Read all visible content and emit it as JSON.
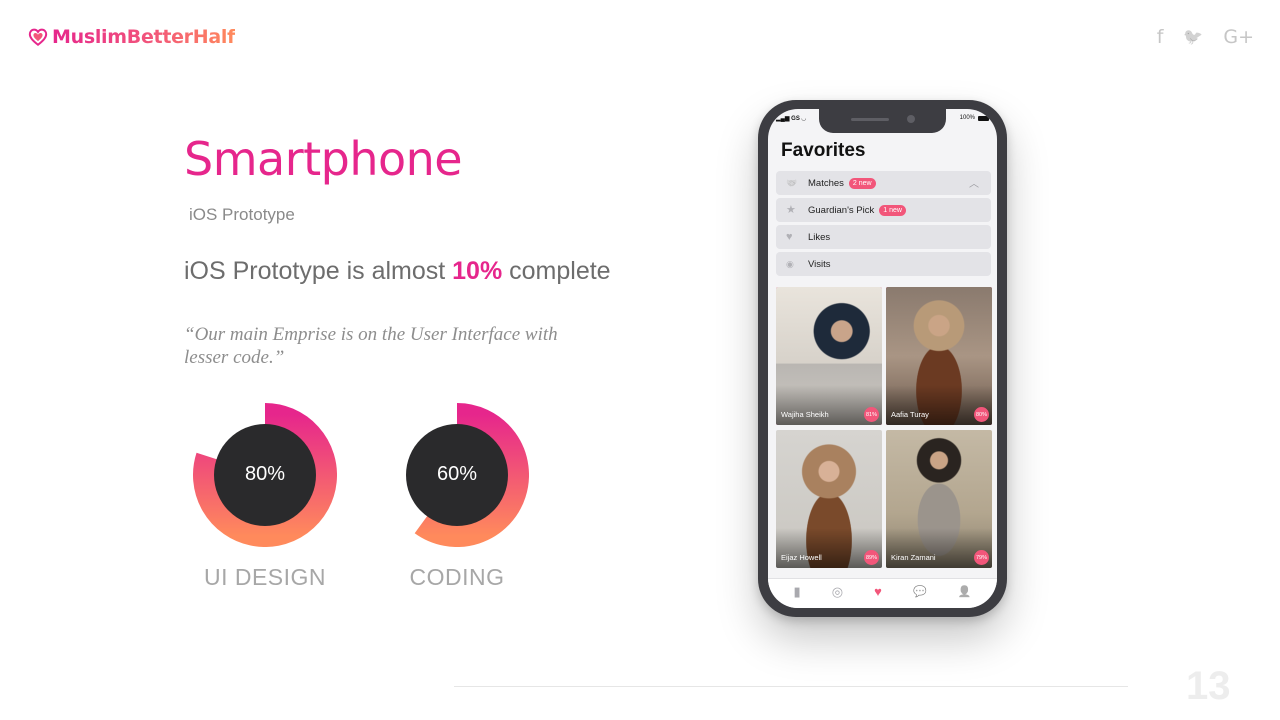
{
  "brand": {
    "name": "MuslimBetterHalf",
    "colors": {
      "pink": "#e6268c",
      "coral": "#f2567a",
      "orange": "#ff8a5c"
    }
  },
  "social": [
    {
      "name": "facebook-icon",
      "glyph": "f"
    },
    {
      "name": "twitter-icon",
      "glyph": "🐦"
    },
    {
      "name": "google-plus-icon",
      "glyph": "G+"
    }
  ],
  "slide": {
    "title": "Smartphone",
    "subtitle": "iOS Prototype",
    "progress_prefix": "iOS Prototype is almost ",
    "progress_value": "10%",
    "progress_suffix": " complete",
    "quote": "“Our main Emprise is on the User Interface with lesser code.”"
  },
  "chart_data": {
    "type": "pie",
    "series": [
      {
        "name": "UI DESIGN",
        "value": 80,
        "display": "80%"
      },
      {
        "name": "CODING",
        "value": 60,
        "display": "60%"
      }
    ]
  },
  "phone": {
    "status_left": "GS",
    "status_right": "100%",
    "screen_title": "Favorites",
    "menu": [
      {
        "label": "Matches",
        "badge": "2 new",
        "icon": "handshake-icon",
        "glyph": "🤝",
        "expanded": true
      },
      {
        "label": "Guardian's Pick",
        "badge": "1 new",
        "icon": "star-icon",
        "glyph": "★"
      },
      {
        "label": "Likes",
        "badge": "",
        "icon": "heart-icon",
        "glyph": "♥"
      },
      {
        "label": "Visits",
        "badge": "",
        "icon": "eye-icon",
        "glyph": "◉"
      }
    ],
    "profiles": [
      {
        "name": "Wajiha Sheikh",
        "match": "81%",
        "liked": true
      },
      {
        "name": "Aafia Turay",
        "match": "80%",
        "liked": true
      },
      {
        "name": "Eijaz Howell",
        "match": "89%",
        "liked": false
      },
      {
        "name": "Kiran Zamani",
        "match": "79%",
        "liked": false
      }
    ],
    "tabs": [
      {
        "name": "tab-cards-icon",
        "glyph": "▮"
      },
      {
        "name": "tab-discover-icon",
        "glyph": "◎"
      },
      {
        "name": "tab-favorites-icon",
        "glyph": "♥",
        "active": true
      },
      {
        "name": "tab-messages-icon",
        "glyph": "💬"
      },
      {
        "name": "tab-profile-icon",
        "glyph": "👤"
      }
    ]
  },
  "page_number": "13"
}
